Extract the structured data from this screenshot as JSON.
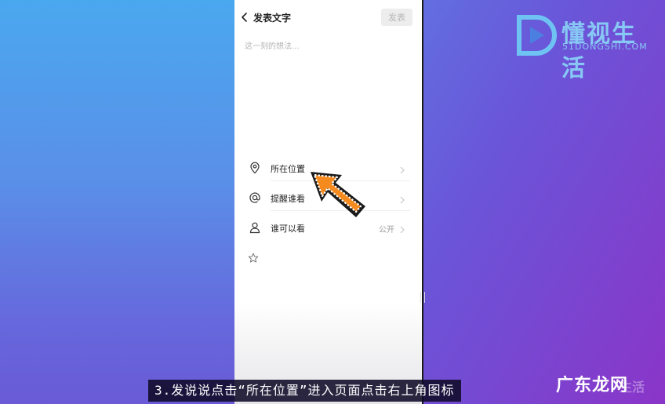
{
  "header": {
    "title": "发表文字",
    "publish_label": "发表"
  },
  "editor": {
    "placeholder": "这一刻的想法..."
  },
  "options": [
    {
      "icon": "location-pin-icon",
      "label": "所在位置",
      "value": ""
    },
    {
      "icon": "at-sign-icon",
      "label": "提醒谁看",
      "value": ""
    },
    {
      "icon": "person-icon",
      "label": "谁可以看",
      "value": "公开"
    }
  ],
  "extra_icon": "star-icon",
  "overlay": {
    "caption": "3.发说说点击“所在位置”进入页面点击右上角图标",
    "brand_name": "懂视生活",
    "brand_domain": "51DONGSHI.COM",
    "watermark": "广东龙网",
    "watermark_ghost": "生活",
    "arrow_color": "#f58a1f",
    "brand_color": "#8ad3f7"
  }
}
